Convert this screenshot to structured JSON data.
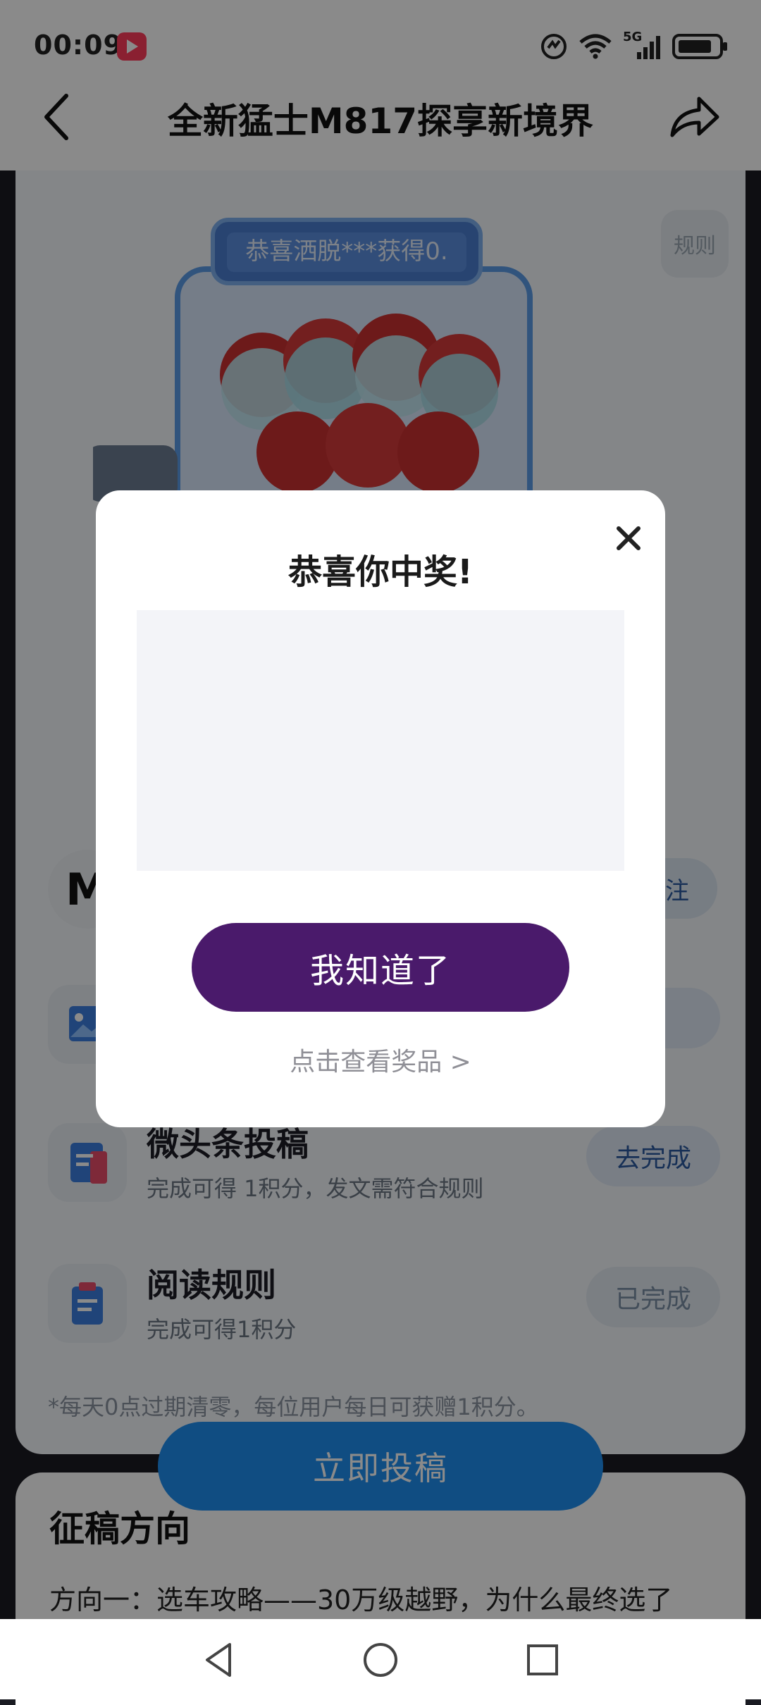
{
  "status_bar": {
    "time": "00:09",
    "icons": [
      "app-notification-icon",
      "data-saver-icon",
      "wifi-icon",
      "signal-5g-icon",
      "battery-icon"
    ],
    "network_label": "5G"
  },
  "header": {
    "title": "全新猛士M817探享新境界",
    "back_icon": "back-icon",
    "share_icon": "share-icon"
  },
  "hero": {
    "ticker_text": "恭喜洒脱***获得0.",
    "rule_label": "规则"
  },
  "brand": {
    "logo_text": "M",
    "follow_label": "注"
  },
  "tasks": [
    {
      "title": "",
      "desc": "",
      "button": "成",
      "icon": "image-icon"
    },
    {
      "title": "微头条投稿",
      "desc": "完成可得 1积分，发文需符合规则",
      "button": "去完成",
      "icon": "document-icon"
    },
    {
      "title": "阅读规则",
      "desc": "完成可得1积分",
      "button": "已完成",
      "icon": "clipboard-icon"
    }
  ],
  "points_note": "*每天0点过期清零，每位用户每日可获赠1积分。",
  "submit_button": "立即投稿",
  "section": {
    "title": "征稿方向",
    "line1": "方向一：选车攻略——30万级越野，为什么最终选了"
  },
  "dialog": {
    "title": "恭喜你中奖!",
    "ok_button": "我知道了",
    "view_prize_link": "点击查看奖品 >",
    "close_icon": "close-icon"
  },
  "navbar": {
    "icons": [
      "nav-back-icon",
      "nav-home-icon",
      "nav-recents-icon"
    ]
  },
  "colors": {
    "dialog_button": "#4a1a6b",
    "submit_button": "#1e8ef0",
    "overlay": "rgba(0,0,0,0.46)"
  }
}
